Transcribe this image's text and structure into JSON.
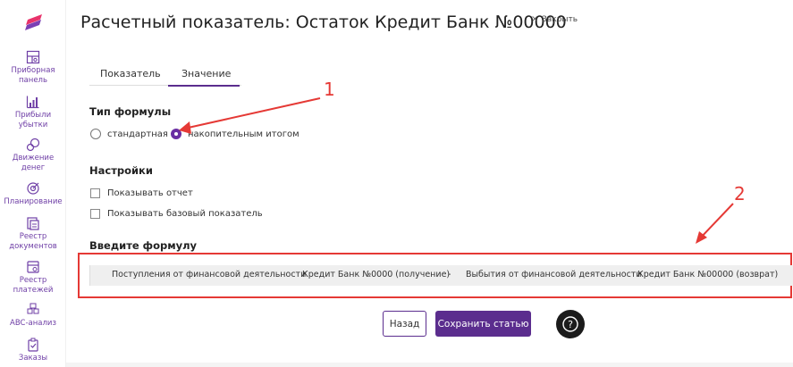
{
  "page": {
    "title": "Расчетный показатель: Остаток Кредит Банк №00000",
    "close_x": "×",
    "close_label": "Закрыть"
  },
  "sidebar": {
    "items": [
      {
        "label": "Приборная\nпанель",
        "icon": "dashboard-icon"
      },
      {
        "label": "Прибыли\nубытки",
        "icon": "profit-chart-icon"
      },
      {
        "label": "Движение\nденег",
        "icon": "money-flow-icon"
      },
      {
        "label": "Планирование",
        "icon": "planning-icon"
      },
      {
        "label": "Реестр\nдокументов",
        "icon": "documents-icon"
      },
      {
        "label": "Реестр\nплатежей",
        "icon": "payments-icon"
      },
      {
        "label": "ABC-анализ",
        "icon": "abc-icon"
      },
      {
        "label": "Заказы",
        "icon": "orders-icon"
      }
    ]
  },
  "tabs": [
    {
      "label": "Показатель",
      "active": false
    },
    {
      "label": "Значение",
      "active": true
    }
  ],
  "formula_type": {
    "title": "Тип формулы",
    "options": [
      {
        "label": "стандартная",
        "checked": false
      },
      {
        "label": "накопительным итогом",
        "checked": true
      }
    ]
  },
  "settings": {
    "title": "Настройки",
    "options": [
      {
        "label": "Показывать отчет",
        "checked": false
      },
      {
        "label": "Показывать базовый показатель",
        "checked": false
      }
    ]
  },
  "formula": {
    "title": "Введите формулу",
    "tokens": [
      "Поступления от финансовой деятельности",
      "Кредит Банк №0000 (получение)",
      "-",
      "Выбытия от финансовой деятельности",
      "Кредит Банк №00000 (возврат)"
    ]
  },
  "buttons": {
    "back": "Назад",
    "save": "Сохранить статью",
    "help": "?"
  },
  "annotations": [
    "1",
    "2"
  ],
  "colors": {
    "accent": "#5b2d8e",
    "annotation": "#e53935",
    "logo": "#e8336b"
  }
}
